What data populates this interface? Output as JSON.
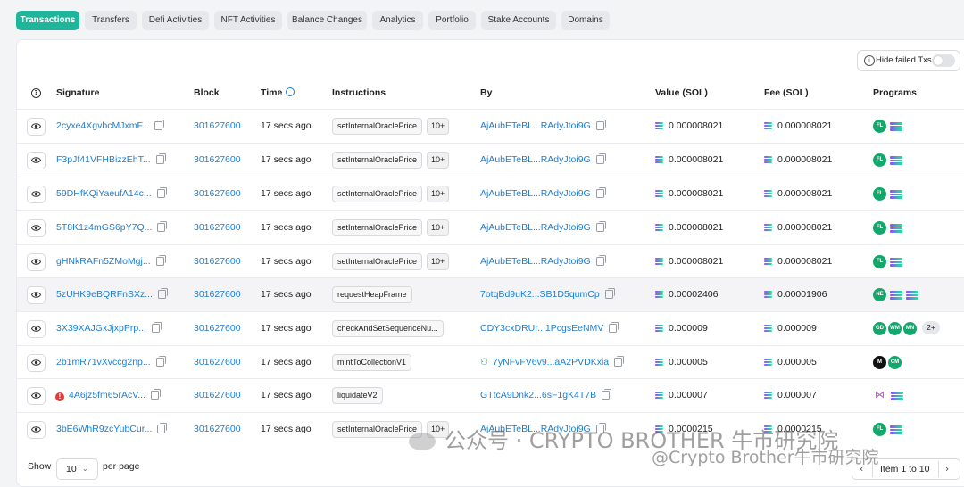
{
  "tabs": [
    "Transactions",
    "Transfers",
    "Defi Activities",
    "NFT Activities",
    "Balance Changes",
    "Analytics",
    "Portfolio",
    "Stake Accounts",
    "Domains"
  ],
  "hide_failed_label": "Hide failed Txs",
  "columns": {
    "signature": "Signature",
    "block": "Block",
    "time": "Time",
    "instructions": "Instructions",
    "by": "By",
    "value": "Value (SOL)",
    "fee": "Fee (SOL)",
    "programs": "Programs"
  },
  "rows": [
    {
      "sig": "2cyxe4XgvbcMJxmF...",
      "block": "301627600",
      "time": "17 secs ago",
      "instr": "setInternalOraclePrice",
      "more": "10+",
      "by": "AjAubETeBL...RAdyJtoi9G",
      "value": "0.000008021",
      "fee": "0.000008021"
    },
    {
      "sig": "F3pJf41VFHBizzEhT...",
      "block": "301627600",
      "time": "17 secs ago",
      "instr": "setInternalOraclePrice",
      "more": "10+",
      "by": "AjAubETeBL...RAdyJtoi9G",
      "value": "0.000008021",
      "fee": "0.000008021"
    },
    {
      "sig": "59DHfKQiYaeufA14c...",
      "block": "301627600",
      "time": "17 secs ago",
      "instr": "setInternalOraclePrice",
      "more": "10+",
      "by": "AjAubETeBL...RAdyJtoi9G",
      "value": "0.000008021",
      "fee": "0.000008021"
    },
    {
      "sig": "5T8K1z4mGS6pY7Q...",
      "block": "301627600",
      "time": "17 secs ago",
      "instr": "setInternalOraclePrice",
      "more": "10+",
      "by": "AjAubETeBL...RAdyJtoi9G",
      "value": "0.000008021",
      "fee": "0.000008021"
    },
    {
      "sig": "gHNkRAFn5ZMoMgj...",
      "block": "301627600",
      "time": "17 secs ago",
      "instr": "setInternalOraclePrice",
      "more": "10+",
      "by": "AjAubETeBL...RAdyJtoi9G",
      "value": "0.000008021",
      "fee": "0.000008021"
    },
    {
      "sig": "5zUHK9eBQRFnSXz...",
      "block": "301627600",
      "time": "17 secs ago",
      "instr": "requestHeapFrame",
      "more": "",
      "by": "7otqBd9uK2...SB1D5qumCp",
      "value": "0.00002406",
      "fee": "0.00001906"
    },
    {
      "sig": "3X39XAJGxJjxpPrp...",
      "block": "301627600",
      "time": "17 secs ago",
      "instr": "checkAndSetSequenceNu...",
      "more": "",
      "by": "CDY3cxDRUr...1PcgsEeNMV",
      "value": "0.000009",
      "fee": "0.000009"
    },
    {
      "sig": "2b1mR71vXvccg2np...",
      "block": "301627600",
      "time": "17 secs ago",
      "instr": "mintToCollectionV1",
      "more": "",
      "by": "7yNFvFV6v9...aA2PVDKxia",
      "value": "0.000005",
      "fee": "0.000005"
    },
    {
      "sig": "4A6jz5fm65rAcV...",
      "block": "301627600",
      "time": "17 secs ago",
      "instr": "liquidateV2",
      "more": "",
      "by": "GTtcA9Dnk2...6sF1gK4T7B",
      "value": "0.000007",
      "fee": "0.000007"
    },
    {
      "sig": "3bE6WhR9zcYubCur...",
      "block": "301627600",
      "time": "17 secs ago",
      "instr": "setInternalOraclePrice",
      "more": "10+",
      "by": "AjAubETeBL...RAdyJtoi9G",
      "value": "0.0000215",
      "fee": "0.0000215"
    }
  ],
  "programs": {
    "r0": [
      "FL"
    ],
    "r1": [
      "FL"
    ],
    "r2": [
      "FL"
    ],
    "r3": [
      "FL"
    ],
    "r4": [
      "FL"
    ],
    "r5": [
      "NE"
    ],
    "r6": [
      "GD",
      "WM",
      "MN"
    ],
    "r6_more": "2+",
    "r7": [
      "NO",
      "CM"
    ],
    "r9": [
      "FL"
    ]
  },
  "footer": {
    "show": "Show",
    "per_page_value": "10",
    "per_page": "per page",
    "page_info": "Item 1 to 10"
  },
  "watermark": {
    "line1": "公众号 · CRYPTO BROTHER 牛市研究院",
    "line2": "@Crypto Brother牛市研究院"
  },
  "colors": {
    "accent": "#1fb59a",
    "link": "#1b7fd4",
    "error": "#e23b3b",
    "program_green": "#12a86b"
  }
}
